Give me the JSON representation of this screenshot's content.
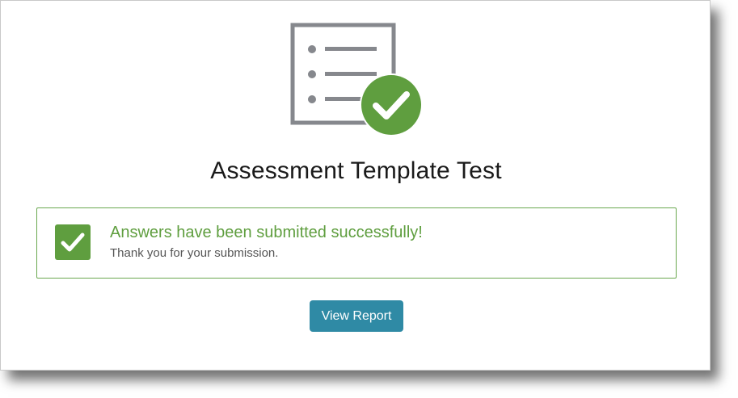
{
  "page": {
    "title": "Assessment Template Test"
  },
  "hero": {
    "icon": "checklist-complete-icon",
    "icon_color": "#86888d",
    "badge_color": "#5f9e3f"
  },
  "alert": {
    "icon": "check-square-icon",
    "title": "Answers have been submitted successfully!",
    "message": "Thank you for your submission.",
    "accent_color": "#5f9e3f"
  },
  "actions": {
    "view_report_label": "View Report",
    "button_color": "#2f8aa5"
  }
}
